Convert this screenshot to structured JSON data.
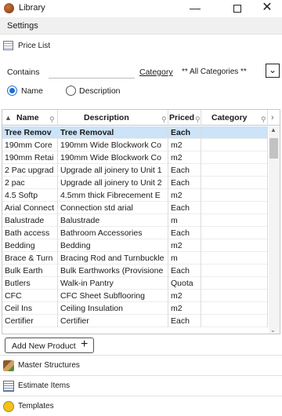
{
  "window": {
    "title": "Library"
  },
  "settings": {
    "label": "Settings"
  },
  "price_list": {
    "label": "Price List"
  },
  "search": {
    "contains_label": "Contains",
    "contains_value": "",
    "category_label": "Category",
    "category_value": "** All Categories **",
    "radio_name": "Name",
    "radio_description": "Description",
    "selected_radio": "Name"
  },
  "table": {
    "columns": [
      "Name",
      "Description",
      "Priced",
      "Category"
    ],
    "rows": [
      {
        "name": "Tree Remov",
        "description": "Tree Removal",
        "priced": "Each",
        "category": ""
      },
      {
        "name": "190mm Core",
        "description": "190mm Wide Blockwork Co",
        "priced": "m2",
        "category": ""
      },
      {
        "name": "190mm Retai",
        "description": "190mm Wide Blockwork Co",
        "priced": "m2",
        "category": ""
      },
      {
        "name": "2 Pac upgrad",
        "description": "Upgrade all joinery to Unit 1",
        "priced": "Each",
        "category": ""
      },
      {
        "name": "2 pac",
        "description": "Upgrade all joinery to Unit 2",
        "priced": "Each",
        "category": ""
      },
      {
        "name": "4.5 Softp",
        "description": "4.5mm thick Fibrecement E",
        "priced": "m2",
        "category": ""
      },
      {
        "name": "Arial Connect",
        "description": "Connection std arial",
        "priced": "Each",
        "category": ""
      },
      {
        "name": "Balustrade",
        "description": "Balustrade",
        "priced": "m",
        "category": ""
      },
      {
        "name": "Bath access",
        "description": "Bathroom Accessories",
        "priced": "Each",
        "category": ""
      },
      {
        "name": "Bedding",
        "description": "Bedding",
        "priced": "m2",
        "category": ""
      },
      {
        "name": "Brace & Turn",
        "description": "Bracing Rod and Turnbuckle",
        "priced": "m",
        "category": ""
      },
      {
        "name": "Bulk Earth",
        "description": "Bulk Earthworks (Provisione",
        "priced": "Each",
        "category": ""
      },
      {
        "name": "Butlers",
        "description": "Walk-in Pantry",
        "priced": "Quota",
        "category": ""
      },
      {
        "name": "CFC",
        "description": "CFC Sheet Subflooring",
        "priced": "m2",
        "category": ""
      },
      {
        "name": "Ceil Ins",
        "description": "Ceiling Insulation",
        "priced": "m2",
        "category": ""
      },
      {
        "name": "Certifier",
        "description": "Certifier",
        "priced": "Each",
        "category": ""
      }
    ],
    "selected_row": 0
  },
  "actions": {
    "add_new_product": "Add New Product"
  },
  "nav": {
    "master_structures": "Master Structures",
    "estimate_items": "Estimate Items",
    "templates": "Templates"
  },
  "colors": {
    "selection": "#cce3f8",
    "radio_accent": "#1f6fd0"
  }
}
